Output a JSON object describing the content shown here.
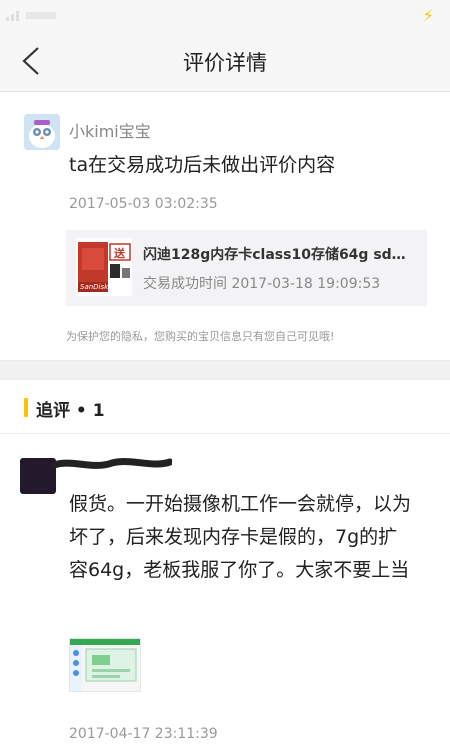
{
  "header": {
    "title": "评价详情"
  },
  "review": {
    "username": "小kimi宝宝",
    "content": "ta在交易成功后未做出评价内容",
    "time": "2017-05-03 03:02:35",
    "product": {
      "name": "闪迪128g内存卡class10存储64g sd卡...",
      "trade_time": "交易成功时间 2017-03-18 19:09:53",
      "thumb_label": "送",
      "thumb_brand": "SanDisk"
    },
    "privacy_note": "为保护您的隐私，您购买的宝贝信息只有您自己可见哦!"
  },
  "followup": {
    "title": "追评 • 1",
    "content": "假货。一开始摄像机工作一会就停，以为坏了，后来发现内存卡是假的，7g的扩容64g，老板我服了你了。大家不要上当",
    "time": "2017-04-17 23:11:39"
  },
  "colors": {
    "accent": "#ffc200",
    "header_bg": "#f7f7f7",
    "card_bg": "#f3f3f5"
  },
  "icons": {
    "back": "chevron-left-icon",
    "status_bolt": "lightning-icon"
  }
}
